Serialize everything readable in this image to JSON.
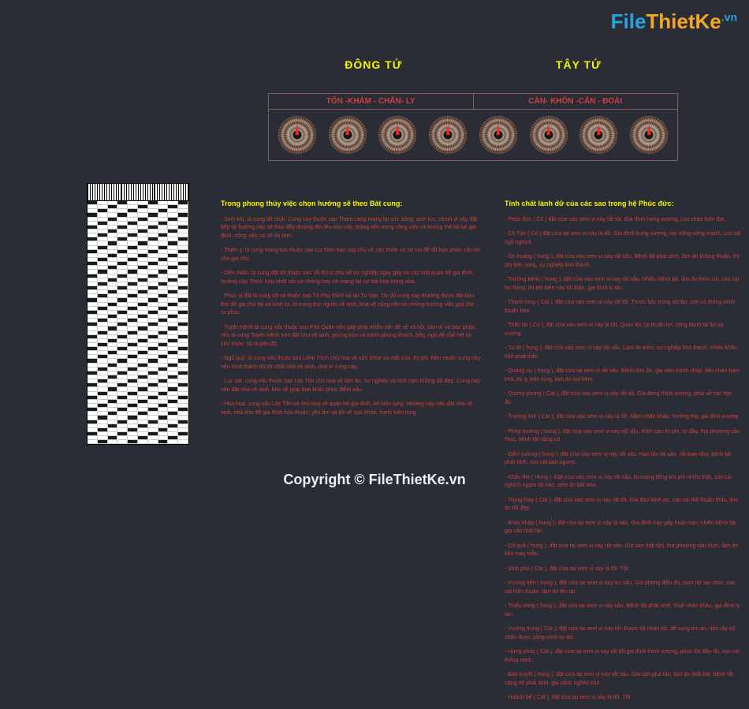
{
  "watermark": {
    "part1": "File",
    "part2": "ThietKe",
    "part3": ".vn"
  },
  "header": {
    "titles": [
      "ĐÔNG TỨ",
      "TÂY TỨ"
    ],
    "subtitles": [
      "TỐN -KHẢM - CHẤN- LY",
      "CÀN- KHÔN -CẤN - ĐOÀI"
    ]
  },
  "left_content": {
    "title": "Trong phong thủy việc chọn hướng sẽ theo Bát cung:",
    "paragraphs": [
      "- Sinh khí, là cung tốt nhất. Cung này thuộc sao Tham Lang mang lại sức sống, sinh lực, chính vì vậy đặt bếp từ hướng này sẽ thúc đẩy đường đời lên như vậy, thăng tiến trong công việc và không thể bỏ bê gia đình, công việc có sẽ ổn hơn.",
      "- Thiên y: là cung mang tức thuộc sao Cự Môn bao này chủ về sức khỏe và sự vui để tất bạn phản cần tới cho gia chủ.",
      "- Diên Niên: là cung đặt tốt thuộc sao Vũ Khúc chủ về sự nghiệp ngày gây và các mối quan hệ gia đình, hướng này Thích hợp nhất với vợ chồng hay sở mạng tại sự bất hòa trong nhà.",
      "- Phục vị đặt là cung tốt và thuộc sao Tả Phụ thích và do Tư bản. Do đó cung này thường được đặt bàn thờ để gia chủ tài và bình tự, bí trong thờ người về sinh, bùa vệ cũng nên tử những hướng việc góc thờ tự phúc.",
      "- Tuyệt mệnh là cung xấu thuộc sao Phá Quân nên gây phải nhiều vấn đề về xã hội, tâm trí và bạc phận, nếu là cung Tuyệt mệnh nên đặt khu vệ sinh, phòng kho và tránh phòng khách, bếp, ngủ để chế hết lọi sức khỏe, tài duyên độ.",
      "- Ngũ quỷ: là cung xấu thuộc sao Liêm Trinh chủ hoạ về sức khỏe và mất của, thị phi. Nên muốn cung này nên hình thành tối tốt nhất nhà vệ sinh, nhơ kì cung này.",
      "- Lục sát: cung xấu thuộc sao Lộc Tồn chủ hoạ về làm ăn, sự nghiệp và tình cảm không tốt đẹp. Cung này nên đặt nhà vệ sinh, kho sẽ giúp bạn khắc phục điểm xấu.",
      "- Họa họa: cung xấu Lộc Tồn và chủ hoạ về quan hệ gia đình, kế hiện tụng. Hướng này nên đặt nhà vệ sinh, nhà kho để gia đình hòa thuận, yên ấm và tốt về sức khỏe, tranh kiện tụng."
    ]
  },
  "right_content": {
    "title": "Tính chất lành dữ của các sao trong hệ Phúc đức:",
    "paragraphs": [
      "- Phúc đức ( Có ) đặt cừa vào xem vị này rất tốt. Gia đình hưng vượng, con cháu hiển đạt.",
      "- Cô Tàn ( Có ) đặt cừa tại xem vị này là tốt. Gia đình hưng vượng, tay năng cứng mạnh, con cái ngỗ nghịch.",
      "- Ôn hoàng ( hung ), đặt cừa vào xem vị này rất xấu. Bệnh tật phải sinh, làm ăn không thuận, thị phi kiện tụng, sự nghiệp khó thành.",
      "- Trường bệnh ( hung ), đặt cừa vào xem vị này rất xấu. Nhiều bệnh tật, làm ăn kém cỏi, con cái hư hỏng, thị phi kiện cáo tội thân, gia đình ly tán.",
      "- Thanh long ( Cát ), đặt cừa vào xem vị này rất tốt. Trước bộc trong tài lâu, con có thông minh thuận hòa.",
      "- Thần tài ( Có ), đặt cừa vào xem vị này là tốt. Quan lộc có thuận lợi, công danh tài lợi và vượng.",
      "- Tư ất ( hung ), đặt cừa vào xem vị này rất xấu. Làm ăn kém, sự nghiệp khó thành, nhiều khâu khổ phát triển.",
      "- Quang sự ( hung ), đặt cừa tại xem vị rất xấu. Bệnh làm ăn, gia viên tranh cháp, liều nhàn hàm khả, thị ly kiện tụng, làm ăn sút kém.",
      "- Quang phong ( Cát ), đặt cừa vào xem vị này rất tốt. Gia đang thịnh vượng, phải về các hộc đủ.",
      "- Trường linh ( Cát ), đặt cừa vào xem vị này là tốt. Nắm nhân khẩu, trưởng thọ, gia đinh vượng.",
      "- Phép trường ( hung ), đặt cừa vào xem vị này rất xấu. Kiện cáo thị phi, tử đầy, tha phương cầu thực, bệnh tật nặng nề.",
      "- Điền cường ( hung ), đặt cừa vào xem vị này rất xấu. Hao tốn tài sản, rối loạn tâm, bệnh tật phải sinh, con cái bạo ngược.",
      "- Khẩu thịt ( Hung ). Đặt cừa vào xem vị này rất xấu. Bị mang tiếng khi phí nhiều thật, con cái nghịch ngạm tài hảo, xem ăn bất hòa.",
      "- Trúng thay ( Cát ), đặt cừa vào xem vị này rất tốt. Gia đạo bình an, con cài thể thuận thảo, làm ăn tốt đẹp.",
      "- Khác kháp ( hung ), đặt cừa tại xem vị này là xấu. Gia đình hay gặp hoạn nạn, nhiều bệnh tật, gia sản thất tận.",
      "- Cô quả ( hung ), đặt cừa tại xem vị này rất xấu. Gia sản thất tận, tha phương cầu thực, làm ăn khó may mắn.",
      "- Vinh phú ( Cát ), đặt cừa tại xem vị này là tốt. Tốt.",
      "- Vương tiền ( hung ), đặt cừa tại xem vị này xự xấu. Gia phòng điểu đủ, nam nữ lao chơi, của cái hiển thuận, làm ăn lện tại.",
      "- Thiếu vong ( hung ), đặt cừa tại xem vị này xấu. Bệnh tật phải sinh, thuế nhàn khâu, gia đình ly tán.",
      "- Vương trung ( Cát ), đặt cừa tại xem vị này tốt. Được tốt nhan tốt, để sung tim an, tiến rầy cố chân được công minh tự dỗ.",
      "- Hưng phúc ( Cát ), đặt cừa tại xem vị này rất tốt gia đình thịnh vượng, phúc lộc đầy đủ, con cái thông minh.",
      "- Bạo kuyết ( hung ), đặt cừa tại xem vị này rất xấu. Gia sản phá tàn, làm ăn thất bát, bệnh tật nặng nề phải sinh, gia cảnh nghèo khó.",
      "- Hoành bể ( Cát ), đặt cừa tại xem vị này là tốt. Tốt."
    ]
  },
  "copyright": "Copyright © FileThietKe.vn"
}
